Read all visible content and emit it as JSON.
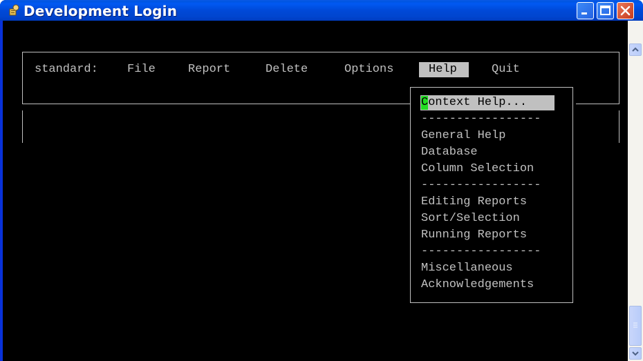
{
  "window": {
    "title": "Development Login"
  },
  "menubar": {
    "prompt": "standard:",
    "items": [
      "File",
      "Report",
      "Delete",
      "Options",
      "Help",
      "Quit"
    ],
    "selected": "Help"
  },
  "help_menu": {
    "items": [
      "Context Help...",
      "-----------------",
      "General Help",
      "Database",
      "Column Selection",
      "-----------------",
      "Editing Reports",
      "Sort/Selection",
      "Running Reports",
      "-----------------",
      "Miscellaneous",
      "Acknowledgements"
    ],
    "highlighted": "Context Help..."
  },
  "icons": {
    "app": "key-icon",
    "minimize": "minimize-icon",
    "maximize": "maximize-icon",
    "close": "close-icon",
    "scroll_up": "chevron-up-icon",
    "scroll_down": "chevron-down-icon"
  },
  "colors": {
    "terminal_bg": "#000000",
    "terminal_fg": "#c0c0c0",
    "cursor": "#22dd22",
    "titlebar": "#0049d8"
  }
}
